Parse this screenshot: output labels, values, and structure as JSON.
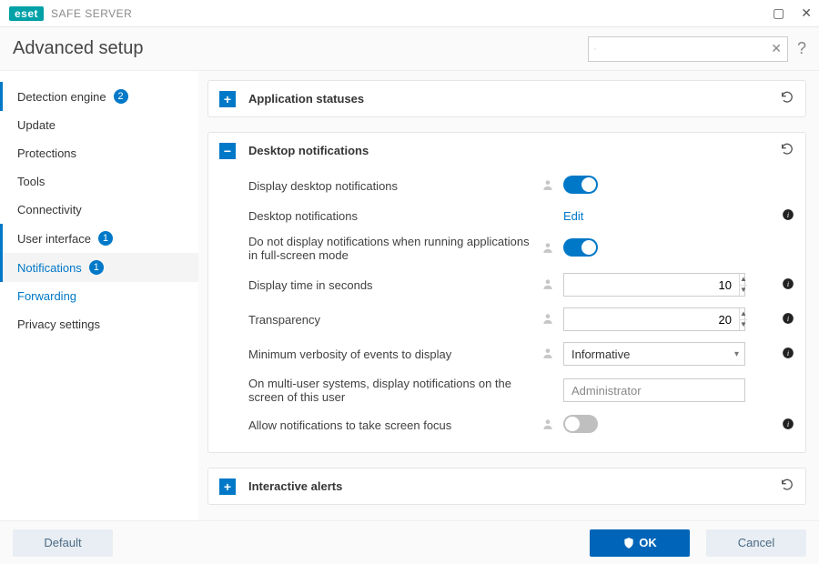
{
  "brand": {
    "logo": "eset",
    "product": "SAFE SERVER"
  },
  "header": {
    "title": "Advanced setup",
    "help": "?"
  },
  "search": {
    "placeholder": "",
    "value": ""
  },
  "sidebar": {
    "items": [
      {
        "label": "Detection engine",
        "badge": "2"
      },
      {
        "label": "Update"
      },
      {
        "label": "Protections"
      },
      {
        "label": "Tools"
      },
      {
        "label": "Connectivity"
      },
      {
        "label": "User interface",
        "badge": "1"
      },
      {
        "label": "Notifications",
        "badge": "1"
      },
      {
        "label": "Forwarding"
      },
      {
        "label": "Privacy settings"
      }
    ]
  },
  "panels": {
    "app_statuses": {
      "title": "Application statuses"
    },
    "desktop_notifications": {
      "title": "Desktop notifications",
      "rows": {
        "display_desktop": {
          "label": "Display desktop notifications",
          "value": true
        },
        "desktop_notifications": {
          "label": "Desktop notifications",
          "link": "Edit"
        },
        "fullscreen": {
          "label": "Do not display notifications when running applications in full-screen mode",
          "value": true
        },
        "display_time": {
          "label": "Display time in seconds",
          "value": "10"
        },
        "transparency": {
          "label": "Transparency",
          "value": "20"
        },
        "verbosity": {
          "label": "Minimum verbosity of events to display",
          "value": "Informative"
        },
        "multi_user": {
          "label": "On multi-user systems, display notifications on the screen of this user",
          "value": "Administrator"
        },
        "screen_focus": {
          "label": "Allow notifications to take screen focus",
          "value": false
        }
      }
    },
    "interactive_alerts": {
      "title": "Interactive alerts"
    }
  },
  "footer": {
    "default": "Default",
    "ok": "OK",
    "cancel": "Cancel"
  }
}
